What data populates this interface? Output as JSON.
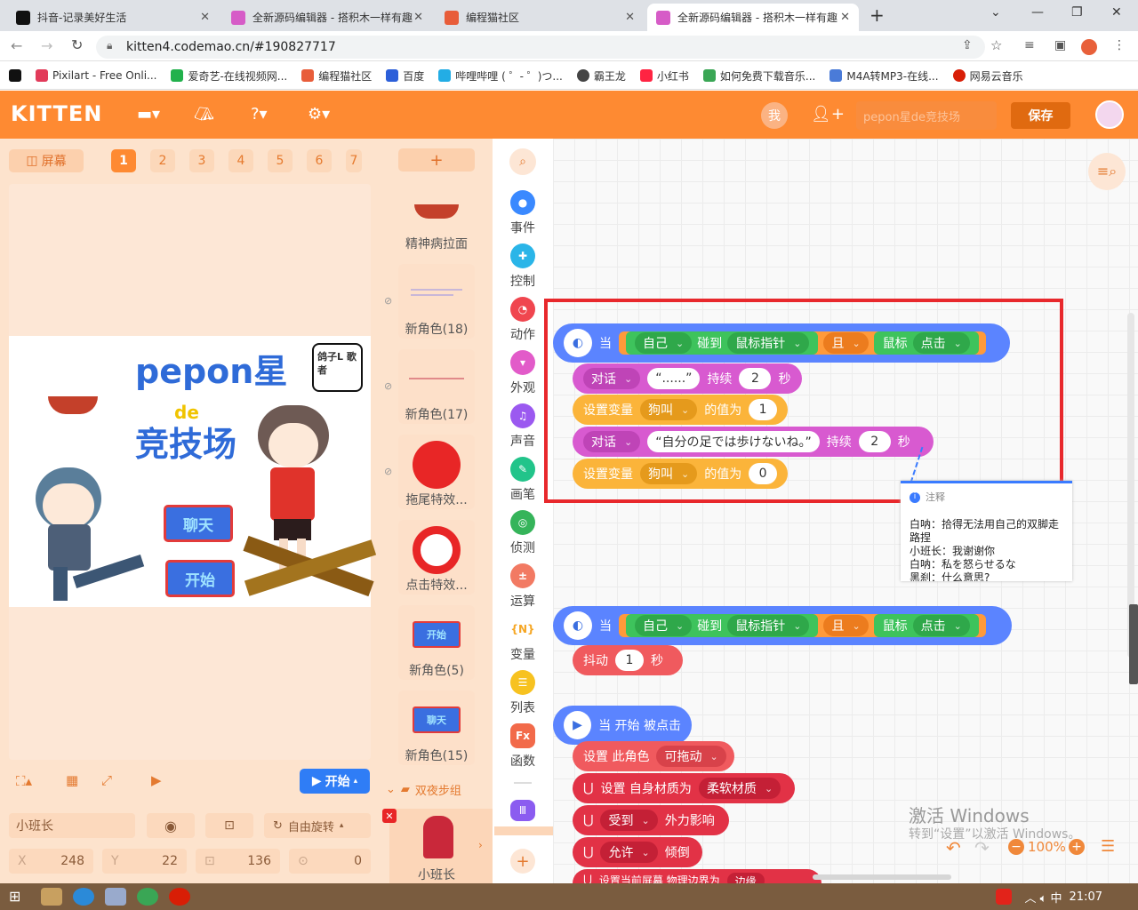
{
  "browser": {
    "tabs": [
      {
        "title": "抖音-记录美好生活",
        "active": false,
        "color": "#111111"
      },
      {
        "title": "全新源码编辑器 - 搭积木一样有趣",
        "active": false,
        "color": "#d65cc7"
      },
      {
        "title": "编程猫社区",
        "active": false,
        "color": "#e85d3a"
      },
      {
        "title": "全新源码编辑器 - 搭积木一样有趣",
        "active": true,
        "color": "#d65cc7"
      }
    ],
    "new_tab": "+",
    "url": "kitten4.codemao.cn/#190827717",
    "bookmarks": [
      "Pixilart - Free Onli...",
      "爱奇艺-在线视频网...",
      "编程猫社区",
      "百度",
      "哔哩哔哩 ( ゜- ゜)つ...",
      "霸王龙",
      "小红书",
      "如何免费下载音乐...",
      "M4A转MP3-在线...",
      "网易云音乐"
    ]
  },
  "app": {
    "logo": "KITTEN",
    "me_badge": "我",
    "work_name": "pepon星de竞技场",
    "save": "保存"
  },
  "stage": {
    "screen_btn": "屏幕",
    "pages": [
      "1",
      "2",
      "3",
      "4",
      "5",
      "6",
      "7"
    ],
    "start": "开始",
    "sprite_name": "小班长",
    "rotation": "自由旋转",
    "x_label": "X",
    "x": "248",
    "y_label": "Y",
    "y": "22",
    "size": "136",
    "direction": "0",
    "canvas": {
      "title_line1": "pepon星",
      "title_line2": "de",
      "title_line3": "竞技场",
      "btn_chat": "聊天",
      "btn_start": "开始",
      "sign": "鸽子L 歌者"
    }
  },
  "sprites": {
    "add": "+",
    "items": [
      "精神病拉面",
      "新角色(18)",
      "新角色(17)",
      "拖尾特效...",
      "点击特效...",
      "新角色(5)",
      "新角色(15)"
    ],
    "card5_text": "开始",
    "card6_text": "聊天",
    "group": "双夜步组",
    "current": "小班长"
  },
  "categories": [
    "事件",
    "控制",
    "动作",
    "外观",
    "声音",
    "画笔",
    "侦测",
    "运算",
    "变量",
    "列表",
    "函数"
  ],
  "scripts": {
    "s1": {
      "when": "当",
      "self": "自己",
      "touch": "碰到",
      "target": "鼠标指针",
      "and": "且",
      "mouse": "鼠标",
      "click": "点击",
      "say1_label": "对话",
      "say1_text": "“......”",
      "say1_dur": "持续",
      "say1_n": "2",
      "sec": "秒",
      "set1": "设置变量",
      "var": "狗叫",
      "valueof": "的值为",
      "v1": "1",
      "say2_label": "对话",
      "say2_text": "“自分の足では歩けないね。”",
      "say2_dur": "持续",
      "say2_n": "2",
      "set2": "设置变量",
      "v2": "0"
    },
    "note": {
      "title": "注释",
      "lines": [
        "白呐：拾得无法用自己的双脚走路捏",
        "小班长：我谢谢你",
        "白呐：私を怒らせるな",
        "黑刹：什么意思?"
      ]
    },
    "s2": {
      "when": "当",
      "self": "自己",
      "touch": "碰到",
      "target": "鼠标指针",
      "and": "且",
      "mouse": "鼠标",
      "click": "点击",
      "shake": "抖动",
      "n": "1",
      "sec": "秒"
    },
    "s3": {
      "when_start": "当 开始 被点击",
      "set_role": "设置 此角色",
      "draggable": "可拖动",
      "set_material": "设置 自身材质为",
      "material": "柔软材质",
      "receive": "受到",
      "external": "外力影响",
      "allow": "允许",
      "tilt": "倾倒",
      "last": "设置当前屏幕 物理边界为",
      "edge": "边缘"
    }
  },
  "zoom": "100%",
  "watermark": {
    "line1": "激活 Windows",
    "line2": "转到“设置”以激活 Windows。"
  },
  "taskbar": {
    "time": "21:07"
  }
}
